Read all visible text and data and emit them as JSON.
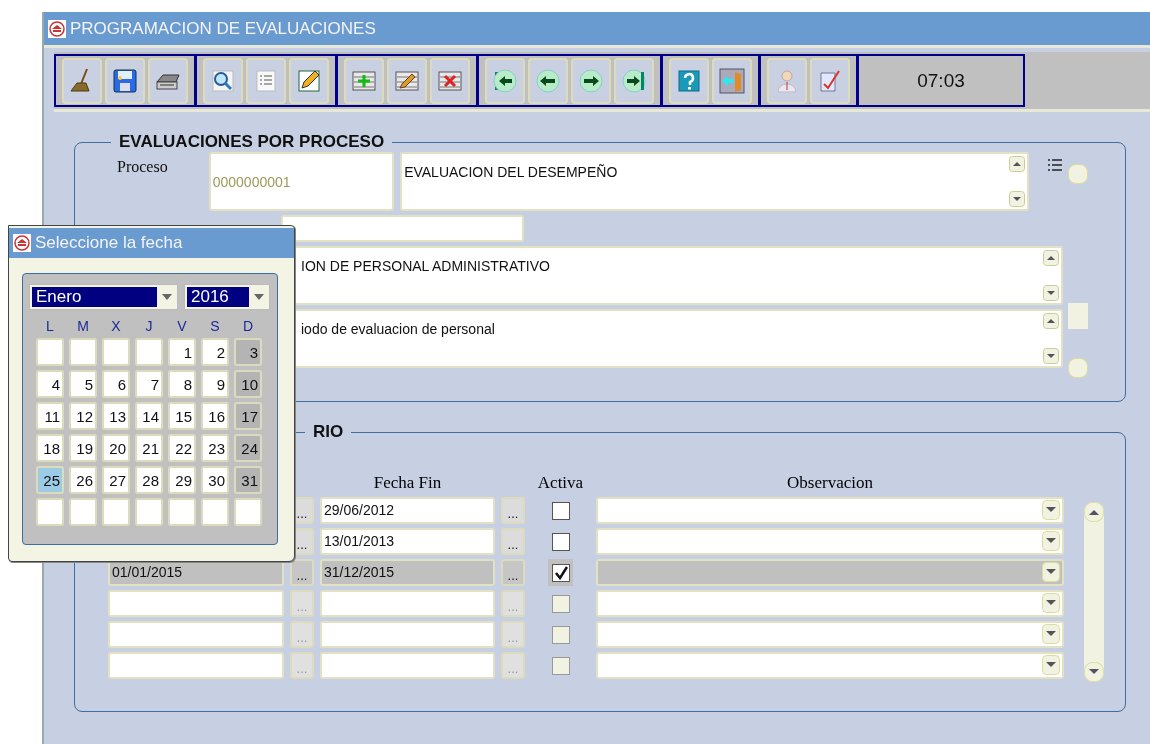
{
  "window": {
    "title": "PROGRAMACION DE EVALUACIONES"
  },
  "toolbar": {
    "groups": [
      {
        "buttons": [
          {
            "kind": "broom"
          },
          {
            "kind": "save"
          },
          {
            "kind": "printer"
          }
        ]
      },
      {
        "buttons": [
          {
            "kind": "search"
          },
          {
            "kind": "list"
          },
          {
            "kind": "pencil"
          }
        ]
      },
      {
        "buttons": [
          {
            "kind": "insert"
          },
          {
            "kind": "modify"
          },
          {
            "kind": "delete"
          }
        ]
      },
      {
        "buttons": [
          {
            "kind": "first"
          },
          {
            "kind": "prev"
          },
          {
            "kind": "next"
          },
          {
            "kind": "last"
          }
        ]
      },
      {
        "buttons": [
          {
            "kind": "help"
          },
          {
            "kind": "exit"
          }
        ]
      },
      {
        "buttons": [
          {
            "kind": "user"
          },
          {
            "kind": "checklist"
          }
        ]
      }
    ],
    "clock": "07:03"
  },
  "process_section": {
    "title": "EVALUACIONES POR PROCESO",
    "label": "Proceso",
    "code": "0000000001",
    "description": "EVALUACION DEL DESEMPEÑO",
    "evaluation_name": "ION DE PERSONAL ADMINISTRATIVO",
    "period_description": "iodo de evaluacion de personal"
  },
  "calendar_section": {
    "title": "RIO",
    "columns": {
      "end_date": "Fecha Fin",
      "active": "Activa",
      "observation": "Observacion"
    },
    "rows": [
      {
        "start_button": "...",
        "end_date": "29/06/2012",
        "end_button": "...",
        "active": false,
        "selected": false,
        "disabled": false
      },
      {
        "start_button": "...",
        "end_date": "13/01/2013",
        "end_button": "...",
        "active": false,
        "selected": false,
        "disabled": false
      },
      {
        "start_date": "01/01/2015",
        "start_button": "...",
        "end_date": "31/12/2015",
        "end_button": "...",
        "active": true,
        "selected": true,
        "disabled": false
      },
      {
        "start_button": "...",
        "end_button": "...",
        "active": false,
        "selected": false,
        "disabled": true
      },
      {
        "start_button": "...",
        "end_button": "...",
        "active": false,
        "selected": false,
        "disabled": true
      },
      {
        "start_button": "...",
        "end_button": "...",
        "active": false,
        "selected": false,
        "disabled": true
      }
    ]
  },
  "date_picker": {
    "title": "Seleccione la fecha",
    "month": "Enero",
    "year": "2016",
    "weekdays": [
      "L",
      "M",
      "X",
      "J",
      "V",
      "S",
      "D"
    ],
    "weeks": [
      [
        {
          "selected": false
        },
        {
          "selected": false
        },
        {
          "selected": false
        },
        {
          "selected": false
        },
        {
          "day": "1",
          "selected": false
        },
        {
          "day": "2",
          "selected": false
        },
        {
          "day": "3",
          "selected": false
        }
      ],
      [
        {
          "day": "4",
          "selected": false
        },
        {
          "day": "5",
          "selected": false
        },
        {
          "day": "6",
          "selected": false
        },
        {
          "day": "7",
          "selected": false
        },
        {
          "day": "8",
          "selected": false
        },
        {
          "day": "9",
          "selected": false
        },
        {
          "day": "10",
          "selected": false
        }
      ],
      [
        {
          "day": "11",
          "selected": false
        },
        {
          "day": "12",
          "selected": false
        },
        {
          "day": "13",
          "selected": false
        },
        {
          "day": "14",
          "selected": false
        },
        {
          "day": "15",
          "selected": false
        },
        {
          "day": "16",
          "selected": false
        },
        {
          "day": "17",
          "selected": false
        }
      ],
      [
        {
          "day": "18",
          "selected": false
        },
        {
          "day": "19",
          "selected": false
        },
        {
          "day": "20",
          "selected": false
        },
        {
          "day": "21",
          "selected": false
        },
        {
          "day": "22",
          "selected": false
        },
        {
          "day": "23",
          "selected": false
        },
        {
          "day": "24",
          "selected": false
        }
      ],
      [
        {
          "day": "25",
          "selected": true
        },
        {
          "day": "26",
          "selected": false
        },
        {
          "day": "27",
          "selected": false
        },
        {
          "day": "28",
          "selected": false
        },
        {
          "day": "29",
          "selected": false
        },
        {
          "day": "30",
          "selected": false
        },
        {
          "day": "31",
          "selected": false
        }
      ],
      [
        {
          "selected": false
        },
        {
          "selected": false
        },
        {
          "selected": false
        },
        {
          "selected": false
        },
        {
          "selected": false
        },
        {
          "selected": false
        },
        {
          "selected": false
        }
      ]
    ]
  }
}
